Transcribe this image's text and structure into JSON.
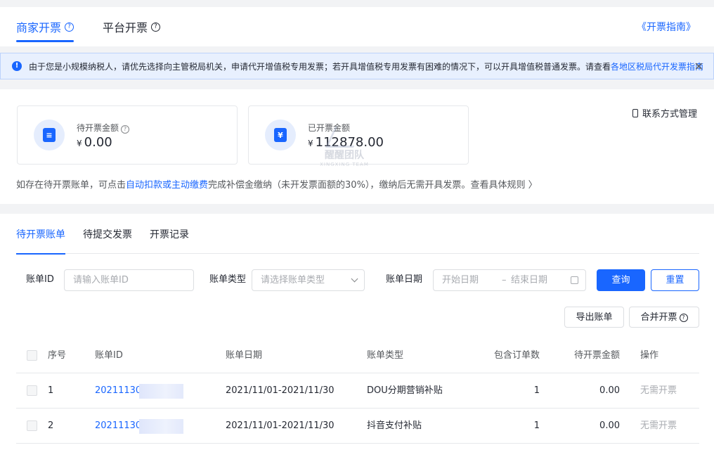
{
  "header": {
    "tabs": [
      {
        "label": "商家开票"
      },
      {
        "label": "平台开票"
      }
    ],
    "guide_link": "《开票指南》"
  },
  "notice": {
    "text": "由于您是小规模纳税人，请优先选择向主管税局机关，申请代开增值税专用发票；若开具增值税专用发票有困难的情况下，可以开具增值税普通发票。请查看",
    "link": "各地区税局代开发票指南"
  },
  "summary": {
    "pending": {
      "label": "待开票金额",
      "currency": "¥",
      "amount": "0.00",
      "icon": "invoice-doc-icon"
    },
    "issued": {
      "label": "已开票金额",
      "currency": "¥",
      "amount": "112878.00",
      "icon": "yen-wallet-icon"
    },
    "contact": "联系方式管理",
    "hint_prefix": "如存在待开票账单，可点击",
    "hint_link": "自动扣款或主动缴费",
    "hint_suffix": "完成补偿金缴纳（未开发票面额的30%），缴纳后无需开具发票。",
    "hint_more": "查看具体规则 〉"
  },
  "watermark": {
    "text": "醒醒团队",
    "sub": "XINGXING TEAM"
  },
  "subtabs": [
    {
      "label": "待开票账单"
    },
    {
      "label": "待提交发票"
    },
    {
      "label": "开票记录"
    }
  ],
  "filters": {
    "bill_id_label": "账单ID",
    "bill_id_placeholder": "请输入账单ID",
    "bill_type_label": "账单类型",
    "bill_type_placeholder": "请选择账单类型",
    "bill_date_label": "账单日期",
    "date_start_placeholder": "开始日期",
    "date_sep": "–",
    "date_end_placeholder": "结束日期",
    "query_button": "查询",
    "reset_button": "重置",
    "export_button": "导出账单",
    "merge_button": "合并开票"
  },
  "table": {
    "columns": [
      "序号",
      "账单ID",
      "账单日期",
      "账单类型",
      "包含订单数",
      "待开票金额",
      "操作"
    ],
    "rows": [
      {
        "index": "1",
        "bill_id": "202111300",
        "date": "2021/11/01-2021/11/30",
        "type": "DOU分期营销补贴",
        "orders": "1",
        "amount": "0.00",
        "action": "无需开票"
      },
      {
        "index": "2",
        "bill_id": "202111300",
        "date": "2021/11/01-2021/11/30",
        "type": "抖音支付补贴",
        "orders": "1",
        "amount": "0.00",
        "action": "无需开票"
      }
    ]
  },
  "colors": {
    "accent": "#1966ff",
    "notice_bg": "#e8f0fe"
  }
}
